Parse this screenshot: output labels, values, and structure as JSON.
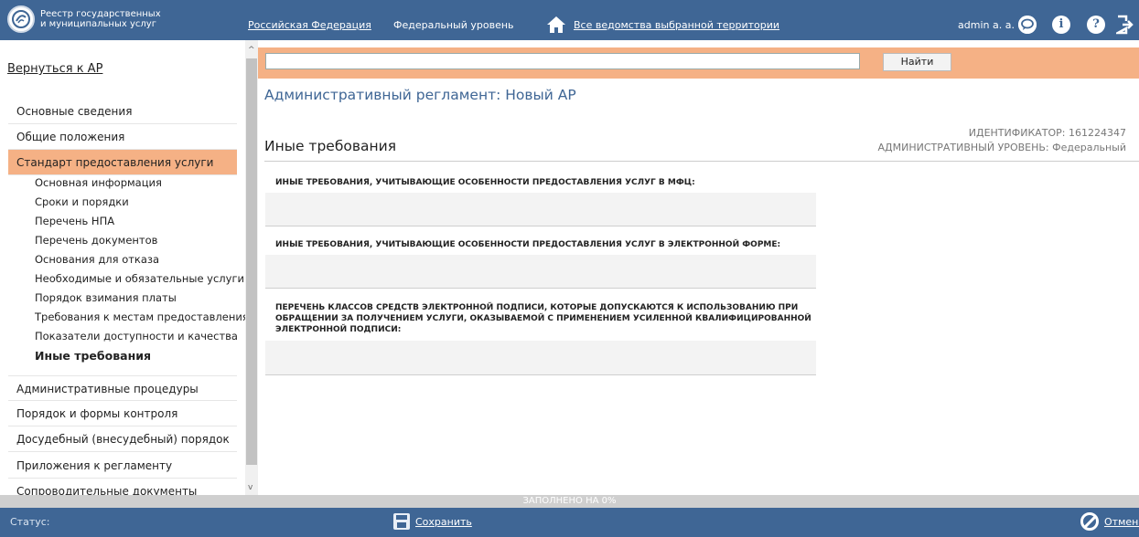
{
  "header": {
    "logo_text": "Реестр государственных и муниципальных услуг",
    "region_link": "Российская Федерация",
    "level_text": "Федеральный уровень",
    "agencies_link": "Все ведомства выбранной территории",
    "user": "admin a. a.",
    "info_icon_glyph": "i",
    "help_icon_glyph": "?"
  },
  "sidebar": {
    "back_link": "Вернуться к АР",
    "sections": [
      "Основные сведения",
      "Общие положения",
      "Стандарт предоставления услуги",
      "Административные процедуры",
      "Порядок и формы контроля",
      "Досудебный (внесудебный) порядок",
      "Приложения к регламенту",
      "Сопроводительные документы"
    ],
    "subitems": [
      "Основная информация",
      "Сроки и порядки",
      "Перечень НПА",
      "Перечень документов",
      "Основания для отказа",
      "Необходимые и обязательные услуги",
      "Порядок взимания платы",
      "Требования к местам предоставления",
      "Показатели доступности и качества",
      "Иные требования"
    ],
    "scroll_up_glyph": "^",
    "scroll_down_glyph": "v"
  },
  "search": {
    "value": "",
    "button": "Найти"
  },
  "main": {
    "page_title": "Административный регламент: Новый АР",
    "identifier": "ИДЕНТИФИКАТОР: 161224347",
    "admin_level": "АДМИНИСТРАТИВНЫЙ УРОВЕНЬ: Федеральный",
    "section_title": "Иные требования",
    "fields": [
      {
        "label": "ИНЫЕ ТРЕБОВАНИЯ, УЧИТЫВАЮЩИЕ ОСОБЕННОСТИ ПРЕДОСТАВЛЕНИЯ УСЛУГ В МФЦ:",
        "value": ""
      },
      {
        "label": "ИНЫЕ ТРЕБОВАНИЯ, УЧИТЫВАЮЩИЕ ОСОБЕННОСТИ ПРЕДОСТАВЛЕНИЯ УСЛУГ В ЭЛЕКТРОННОЙ ФОРМЕ:",
        "value": ""
      },
      {
        "label": "ПЕРЕЧЕНЬ КЛАССОВ СРЕДСТВ ЭЛЕКТРОННОЙ ПОДПИСИ, КОТОРЫЕ ДОПУСКАЮТСЯ К ИСПОЛЬЗОВАНИЮ ПРИ ОБРАЩЕНИИ ЗА ПОЛУЧЕНИЕМ УСЛУГИ, ОКАЗЫВАЕМОЙ С ПРИМЕНЕНИЕМ УСИЛЕННОЙ КВАЛИФИЦИРОВАННОЙ ЭЛЕКТРОННОЙ ПОДПИСИ:",
        "value": ""
      }
    ]
  },
  "footer": {
    "progress_text": "ЗАПОЛНЕНО НА 0%",
    "progress_value": 0,
    "status_label": "Статус:",
    "save": "Сохранить",
    "cancel": "Отменить"
  },
  "colors": {
    "header_bg": "#3f6695",
    "accent_orange": "#f5b185",
    "title_blue": "#3f6695"
  },
  "icons": [
    "logo-icon",
    "home-icon",
    "chat-icon",
    "info-icon",
    "help-icon",
    "logout-icon",
    "save-icon",
    "cancel-icon"
  ]
}
